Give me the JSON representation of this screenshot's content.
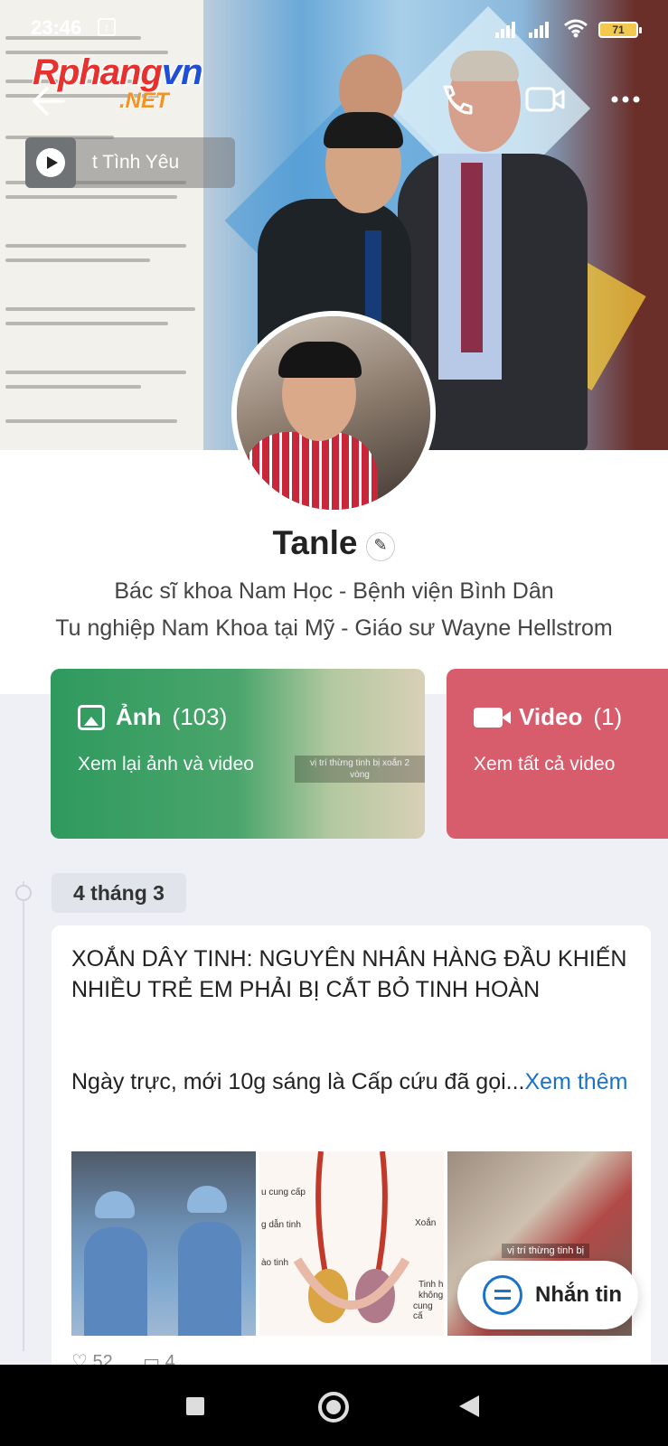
{
  "status_bar": {
    "time": "23:46",
    "battery": "71"
  },
  "watermark": {
    "logo_main": "Rphang",
    "logo_vn": "vn",
    "logo_suffix": ".NET"
  },
  "music": {
    "song": "t Tình Yêu"
  },
  "profile": {
    "name": "Tanle",
    "bio_line1": "Bác sĩ khoa Nam Học - Bệnh viện Bình Dân",
    "bio_line2": "Tu nghiệp Nam Khoa tại Mỹ - Giáo sư Wayne Hellstrom"
  },
  "cards": {
    "photos": {
      "title": "Ảnh",
      "count": "(103)",
      "subtitle": "Xem lại ảnh và video",
      "overlay": "vị trí thừng tinh bị xoắn 2 vòng"
    },
    "video": {
      "title": "Video",
      "count": "(1)",
      "subtitle": "Xem tất cả video"
    }
  },
  "timeline": {
    "date": "4 tháng 3"
  },
  "post": {
    "headline": "XOẮN DÂY TINH: NGUYÊN NHÂN HÀNG ĐẦU KHIẾN NHIỀU TRẺ EM PHẢI BỊ CẮT BỎ TINH HOÀN",
    "body": "Ngày trực, mới 10g sáng là Cấp cứu đã gọi...",
    "more": "Xem thêm",
    "photo2_labels": [
      "u cung cấp",
      "g dẫn tinh",
      "ào tinh",
      "Xoắn",
      "Tinh h",
      "không",
      "cung cấ"
    ],
    "photo3_label": "vị trí thừng tinh bị",
    "likes": "52",
    "comments": "4"
  },
  "chat_button": {
    "label": "Nhắn tin"
  },
  "colors": {
    "accent": "#1a73c8",
    "photos_card": "#2f9a5e",
    "video_card": "#d75d6d"
  }
}
